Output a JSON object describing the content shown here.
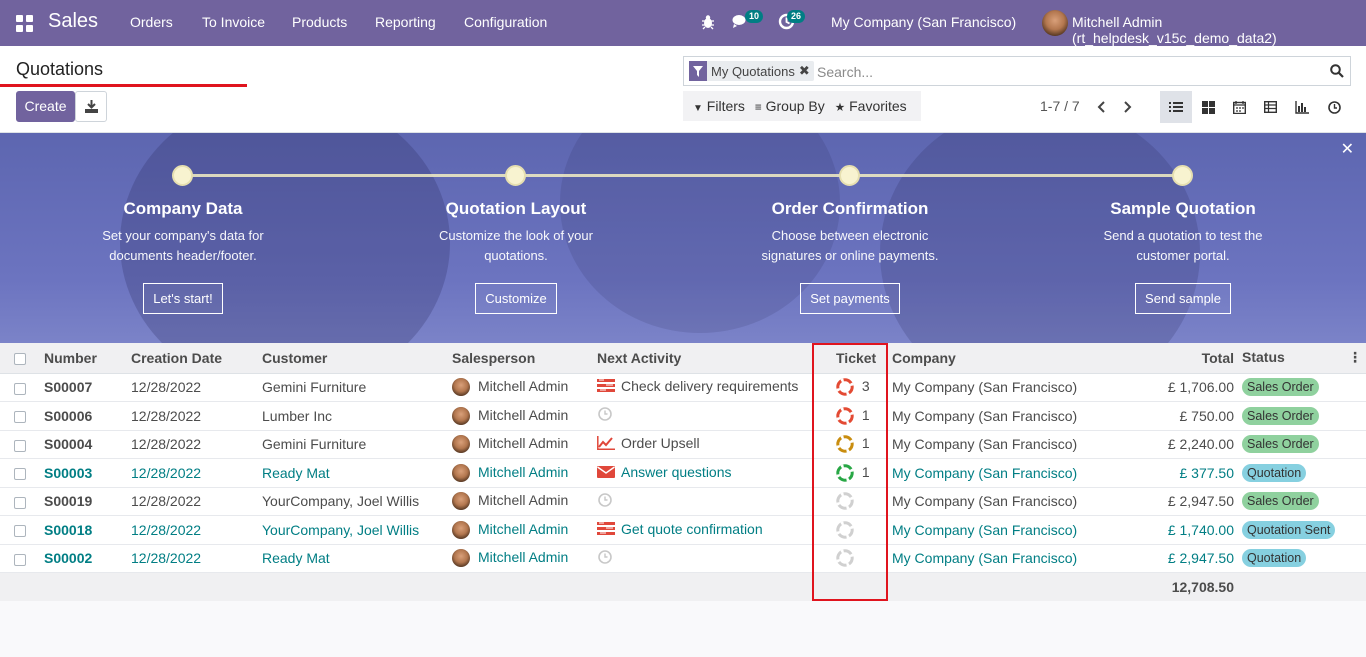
{
  "navbar": {
    "app_name": "Sales",
    "menus": [
      "Orders",
      "To Invoice",
      "Products",
      "Reporting",
      "Configuration"
    ],
    "messages_count": "10",
    "activities_count": "26",
    "company": "My Company (San Francisco)",
    "user": "Mitchell Admin (rt_helpdesk_v15c_demo_data2)"
  },
  "control": {
    "breadcrumb": "Quotations",
    "create_label": "Create",
    "facet_label": "My Quotations",
    "search_placeholder": "Search...",
    "filters_label": "Filters",
    "groupby_label": "Group By",
    "favorites_label": "Favorites",
    "pager": "1-7 / 7"
  },
  "onboarding": {
    "steps": [
      {
        "title": "Company Data",
        "desc": "Set your company's data for documents header/footer.",
        "button": "Let's start!"
      },
      {
        "title": "Quotation Layout",
        "desc": "Customize the look of your quotations.",
        "button": "Customize"
      },
      {
        "title": "Order Confirmation",
        "desc": "Choose between electronic signatures or online payments.",
        "button": "Set payments"
      },
      {
        "title": "Sample Quotation",
        "desc": "Send a quotation to test the customer portal.",
        "button": "Send sample"
      }
    ]
  },
  "table": {
    "headers": {
      "number": "Number",
      "date": "Creation Date",
      "customer": "Customer",
      "salesperson": "Salesperson",
      "activity": "Next Activity",
      "ticket": "Ticket",
      "company": "Company",
      "total": "Total",
      "status": "Status"
    },
    "rows": [
      {
        "number": "S00007",
        "date": "12/28/2022",
        "customer": "Gemini Furniture",
        "salesperson": "Mitchell Admin",
        "activity": "Check delivery requirements",
        "activity_icon": "tasks-icon",
        "ticket": "3",
        "ticket_color": "#e34a33",
        "company": "My Company (San Francisco)",
        "total": "£ 1,706.00",
        "status": "Sales Order",
        "status_color": "#8fd19e",
        "quotation": false
      },
      {
        "number": "S00006",
        "date": "12/28/2022",
        "customer": "Lumber Inc",
        "salesperson": "Mitchell Admin",
        "activity": "",
        "activity_icon": "clock-icon",
        "ticket": "1",
        "ticket_color": "#e34a33",
        "company": "My Company (San Francisco)",
        "total": "£ 750.00",
        "status": "Sales Order",
        "status_color": "#8fd19e",
        "quotation": false
      },
      {
        "number": "S00004",
        "date": "12/28/2022",
        "customer": "Gemini Furniture",
        "salesperson": "Mitchell Admin",
        "activity": "Order Upsell",
        "activity_icon": "chart-icon",
        "ticket": "1",
        "ticket_color": "#c98d0f",
        "company": "My Company (San Francisco)",
        "total": "£ 2,240.00",
        "status": "Sales Order",
        "status_color": "#8fd19e",
        "quotation": false
      },
      {
        "number": "S00003",
        "date": "12/28/2022",
        "customer": "Ready Mat",
        "salesperson": "Mitchell Admin",
        "activity": "Answer questions",
        "activity_icon": "envelope-icon",
        "ticket": "1",
        "ticket_color": "#28a745",
        "company": "My Company (San Francisco)",
        "total": "£ 377.50",
        "status": "Quotation",
        "status_color": "#86d0e0",
        "quotation": true
      },
      {
        "number": "S00019",
        "date": "12/28/2022",
        "customer": "YourCompany, Joel Willis",
        "salesperson": "Mitchell Admin",
        "activity": "",
        "activity_icon": "clock-icon",
        "ticket": "",
        "ticket_color": "#d0d0d0",
        "company": "My Company (San Francisco)",
        "total": "£ 2,947.50",
        "status": "Sales Order",
        "status_color": "#8fd19e",
        "quotation": false
      },
      {
        "number": "S00018",
        "date": "12/28/2022",
        "customer": "YourCompany, Joel Willis",
        "salesperson": "Mitchell Admin",
        "activity": "Get quote confirmation",
        "activity_icon": "tasks-icon",
        "ticket": "",
        "ticket_color": "#d0d0d0",
        "company": "My Company (San Francisco)",
        "total": "£ 1,740.00",
        "status": "Quotation Sent",
        "status_color": "#86d0e0",
        "quotation": true
      },
      {
        "number": "S00002",
        "date": "12/28/2022",
        "customer": "Ready Mat",
        "salesperson": "Mitchell Admin",
        "activity": "",
        "activity_icon": "clock-icon",
        "ticket": "",
        "ticket_color": "#d0d0d0",
        "company": "My Company (San Francisco)",
        "total": "£ 2,947.50",
        "status": "Quotation",
        "status_color": "#86d0e0",
        "quotation": true
      }
    ],
    "footer_total": "12,708.50"
  }
}
